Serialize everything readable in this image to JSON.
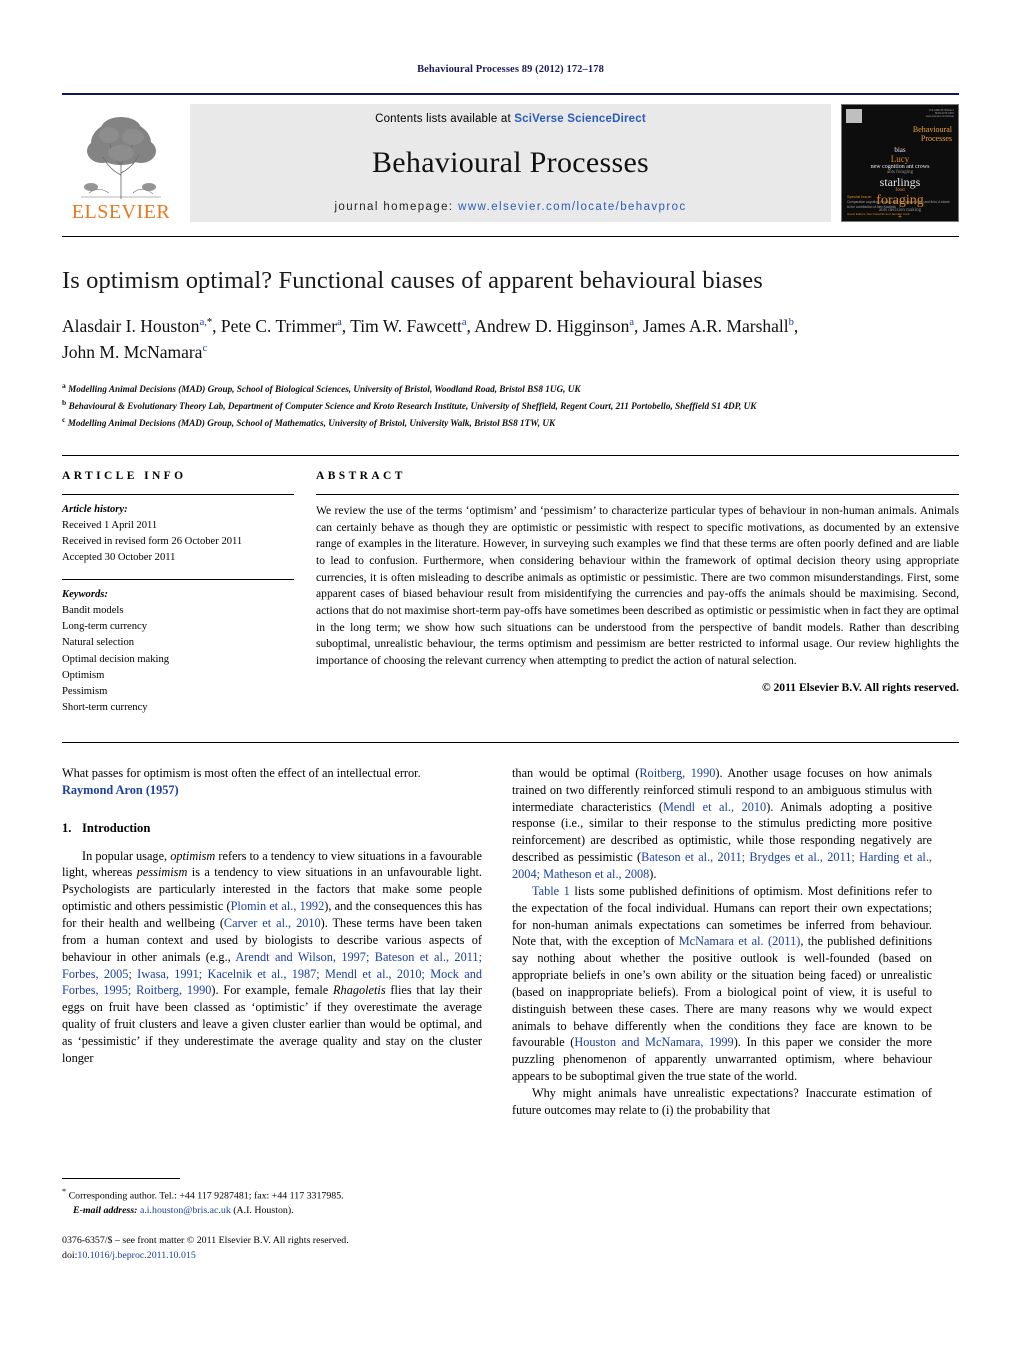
{
  "running_head": "Behavioural Processes 89 (2012) 172–178",
  "masthead": {
    "contents_prefix": "Contents lists available at ",
    "sciencedirect": "SciVerse ScienceDirect",
    "journal_name": "Behavioural Processes",
    "homepage_label": "journal homepage:",
    "homepage_url": "www.elsevier.com/locate/behavproc",
    "publisher": "ELSEVIER",
    "cover": {
      "title_line1": "Behavioural",
      "title_line2": "Processes",
      "cloud": [
        "bias",
        "Lucy",
        "new cognition ant crows",
        "ants foraging",
        "starlings",
        "food",
        "foraging",
        "ants decision making",
        "+"
      ],
      "special_issue_label": "Special Issue:",
      "special_issue_text": "Comparative cognition: function and mechanism in lab and field,  A tribute to the contribution of Alex Kacelnik",
      "editors": "Guest Editors: Alex Kacelnik and Jennifer Vonk"
    }
  },
  "article": {
    "title": "Is optimism optimal? Functional causes of apparent behavioural biases",
    "authors": [
      {
        "name": "Alasdair I. Houston",
        "sup": "a,",
        "star": true
      },
      {
        "name": "Pete C. Trimmer",
        "sup": "a"
      },
      {
        "name": "Tim W. Fawcett",
        "sup": "a"
      },
      {
        "name": "Andrew D. Higginson",
        "sup": "a"
      },
      {
        "name": "James A.R. Marshall",
        "sup": "b"
      },
      {
        "name": "John M. McNamara",
        "sup": "c"
      }
    ],
    "authors_line1": "Alasdair I. Houston<sup>a,*</sup>, Pete C. Trimmer<sup>a</sup>, Tim W. Fawcett<sup>a</sup>, Andrew D. Higginson<sup>a</sup>, James A.R. Marshall<sup>b</sup>,",
    "authors_line2": "John M. McNamara<sup>c</sup>",
    "affiliations": [
      {
        "mark": "a",
        "text": "Modelling Animal Decisions (MAD) Group, School of Biological Sciences, University of Bristol, Woodland Road, Bristol BS8 1UG, UK"
      },
      {
        "mark": "b",
        "text": "Behavioural & Evolutionary Theory Lab, Department of Computer Science and Kroto Research Institute, University of Sheffield, Regent Court, 211 Portobello, Sheffield S1 4DP, UK"
      },
      {
        "mark": "c",
        "text": "Modelling Animal Decisions (MAD) Group, School of Mathematics, University of Bristol, University Walk, Bristol BS8 1TW, UK"
      }
    ]
  },
  "article_info": {
    "heading": "ARTICLE INFO",
    "history_label": "Article history:",
    "history": [
      "Received 1 April 2011",
      "Received in revised form 26 October 2011",
      "Accepted 30 October 2011"
    ],
    "keywords_label": "Keywords:",
    "keywords": [
      "Bandit models",
      "Long-term currency",
      "Natural selection",
      "Optimal decision making",
      "Optimism",
      "Pessimism",
      "Short-term currency"
    ]
  },
  "abstract": {
    "heading": "ABSTRACT",
    "text": "We review the use of the terms ‘optimism’ and ‘pessimism’ to characterize particular types of behaviour in non-human animals. Animals can certainly behave as though they are optimistic or pessimistic with respect to specific motivations, as documented by an extensive range of examples in the literature. However, in surveying such examples we find that these terms are often poorly defined and are liable to lead to confusion. Furthermore, when considering behaviour within the framework of optimal decision theory using appropriate currencies, it is often misleading to describe animals as optimistic or pessimistic. There are two common misunderstandings. First, some apparent cases of biased behaviour result from misidentifying the currencies and pay-offs the animals should be maximising. Second, actions that do not maximise short-term pay-offs have sometimes been described as optimistic or pessimistic when in fact they are optimal in the long term; we show how such situations can be understood from the perspective of bandit models. Rather than describing suboptimal, unrealistic behaviour, the terms optimism and pessimism are better restricted to informal usage. Our review highlights the importance of choosing the relevant currency when attempting to predict the action of natural selection.",
    "copyright": "© 2011 Elsevier B.V. All rights reserved."
  },
  "body": {
    "epigraph": "What passes for optimism is most often the effect of an intellectual error.",
    "epigraph_attribution": "Raymond Aron (1957)",
    "section1_number": "1.",
    "section1_title": "Introduction",
    "left_para1_a": "In popular usage, ",
    "left_para1_opt": "optimism",
    "left_para1_b": " refers to a tendency to view situations in a favourable light, whereas ",
    "left_para1_pess": "pessimism",
    "left_para1_c": " is a tendency to view situations in an unfavourable light. Psychologists are particularly interested in the factors that make some people optimistic and others pessimistic (",
    "cite_plomin": "Plomin et al., 1992",
    "left_para1_d": "), and the consequences this has for their health and wellbeing (",
    "cite_carver": "Carver et al., 2010",
    "left_para1_e": "). These terms have been taken from a human context and used by biologists to describe various aspects of behaviour in other animals (e.g., ",
    "cite_list1": "Arendt and Wilson, 1997; Bateson et al., 2011; Forbes, 2005; Iwasa, 1991; Kacelnik et al., 1987; Mendl et al., 2010; Mock and Forbes, 1995; Roitberg, 1990",
    "left_para1_f": "). For example, female ",
    "left_para1_genus": "Rhagoletis",
    "left_para1_g": " flies that lay their eggs on fruit have been classed as ‘optimistic’ if they overestimate the average quality of fruit clusters and leave a given cluster earlier than would be optimal, and as ‘pessimistic’ if they underestimate the average quality and stay on the cluster longer",
    "right_para1_a": "than would be optimal (",
    "cite_roitberg": "Roitberg, 1990",
    "right_para1_b": "). Another usage focuses on how animals trained on two differently reinforced stimuli respond to an ambiguous stimulus with intermediate characteristics (",
    "cite_mendl": "Mendl et al., 2010",
    "right_para1_c": "). Animals adopting a positive response (i.e., similar to their response to the stimulus predicting more positive reinforcement) are described as optimistic, while those responding negatively are described as pessimistic (",
    "cite_list2": "Bateson et al., 2011; Brydges et al., 2011; Harding et al., 2004; Matheson et al., 2008",
    "right_para1_d": ").",
    "right_para2_table": "Table 1",
    "right_para2_a": " lists some published definitions of optimism. Most definitions refer to the expectation of the focal individual. Humans can report their own expectations; for non-human animals expectations can sometimes be inferred from behaviour. Note that, with the exception of ",
    "cite_mcnamara": "McNamara et al. (2011)",
    "right_para2_b": ", the published definitions say nothing about whether the positive outlook is well-founded (based on appropriate beliefs in one’s own ability or the situation being faced) or unrealistic (based on inappropriate beliefs). From a biological point of view, it is useful to distinguish between these cases. There are many reasons why we would expect animals to behave differently when the conditions they face are known to be favourable (",
    "cite_houston": "Houston and McNamara, 1999",
    "right_para2_c": "). In this paper we consider the more puzzling phenomenon of apparently unwarranted optimism, where behaviour appears to be suboptimal given the true state of the world.",
    "right_para3": "Why might animals have unrealistic expectations? Inaccurate estimation of future outcomes may relate to (i) the probability that"
  },
  "footnote": {
    "marker": "*",
    "corresponding": "Corresponding author. Tel.: +44 117 9287481; fax: +44 117 3317985.",
    "email_label": "E-mail address:",
    "email": "a.i.houston@bris.ac.uk",
    "email_owner": "(A.I. Houston)."
  },
  "imprint": {
    "issn_line": "0376-6357/$ – see front matter © 2011 Elsevier B.V. All rights reserved.",
    "doi_label": "doi:",
    "doi": "10.1016/j.beproc.2011.10.015"
  },
  "colors": {
    "link_blue": "#1a3fa0",
    "sd_blue": "#2a5cb8",
    "elsevier_orange": "#e87722",
    "rule_navy": "#15155a"
  }
}
